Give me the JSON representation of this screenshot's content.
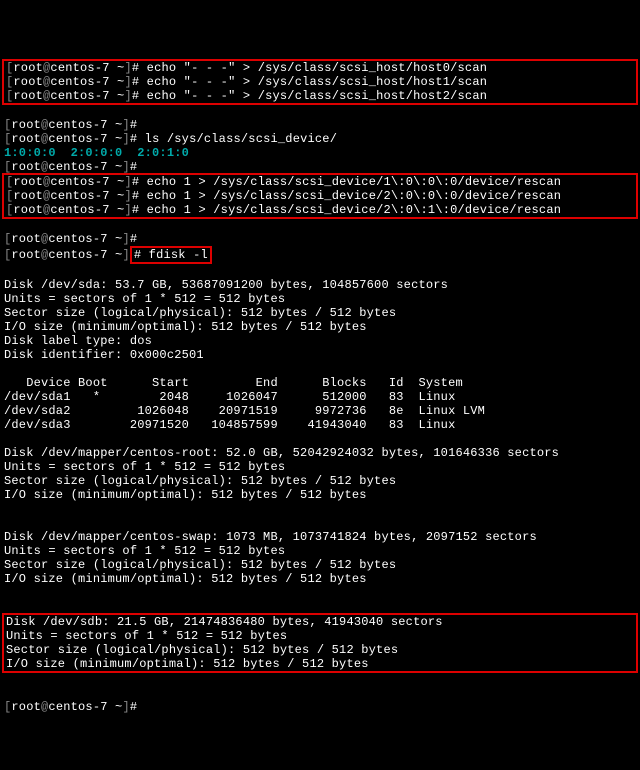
{
  "prompt": {
    "open": "[",
    "user": "root",
    "at": "@",
    "host": "centos-7",
    "path": " ~",
    "close": "]",
    "hash": "# "
  },
  "cmd": {
    "scan0": "echo \"- - -\" > /sys/class/scsi_host/host0/scan",
    "scan1": "echo \"- - -\" > /sys/class/scsi_host/host1/scan",
    "scan2": "echo \"- - -\" > /sys/class/scsi_host/host2/scan",
    "ls_scsi": "ls /sys/class/scsi_device/",
    "rescan1": "echo 1 > /sys/class/scsi_device/1\\:0\\:0\\:0/device/rescan",
    "rescan2": "echo 1 > /sys/class/scsi_device/2\\:0\\:0\\:0/device/rescan",
    "rescan3": "echo 1 > /sys/class/scsi_device/2\\:0\\:1\\:0/device/rescan",
    "fdisk": "fdisk -l"
  },
  "ls_output": "1:0:0:0  2:0:0:0  2:0:1:0",
  "sda": {
    "l1": "Disk /dev/sda: 53.7 GB, 53687091200 bytes, 104857600 sectors",
    "l2": "Units = sectors of 1 * 512 = 512 bytes",
    "l3": "Sector size (logical/physical): 512 bytes / 512 bytes",
    "l4": "I/O size (minimum/optimal): 512 bytes / 512 bytes",
    "l5": "Disk label type: dos",
    "l6": "Disk identifier: 0x000c2501"
  },
  "ptable": {
    "hdr": "   Device Boot      Start         End      Blocks   Id  System",
    "r1": "/dev/sda1   *        2048     1026047      512000   83  Linux",
    "r2": "/dev/sda2         1026048    20971519     9972736   8e  Linux LVM",
    "r3": "/dev/sda3        20971520   104857599    41943040   83  Linux"
  },
  "root": {
    "l1": "Disk /dev/mapper/centos-root: 52.0 GB, 52042924032 bytes, 101646336 sectors",
    "l2": "Units = sectors of 1 * 512 = 512 bytes",
    "l3": "Sector size (logical/physical): 512 bytes / 512 bytes",
    "l4": "I/O size (minimum/optimal): 512 bytes / 512 bytes"
  },
  "swap": {
    "l1": "Disk /dev/mapper/centos-swap: 1073 MB, 1073741824 bytes, 2097152 sectors",
    "l2": "Units = sectors of 1 * 512 = 512 bytes",
    "l3": "Sector size (logical/physical): 512 bytes / 512 bytes",
    "l4": "I/O size (minimum/optimal): 512 bytes / 512 bytes"
  },
  "sdb": {
    "l1": "Disk /dev/sdb: 21.5 GB, 21474836480 bytes, 41943040 sectors",
    "l2": "Units = sectors of 1 * 512 = 512 bytes",
    "l3": "Sector size (logical/physical): 512 bytes / 512 bytes",
    "l4": "I/O size (minimum/optimal): 512 bytes / 512 bytes"
  }
}
